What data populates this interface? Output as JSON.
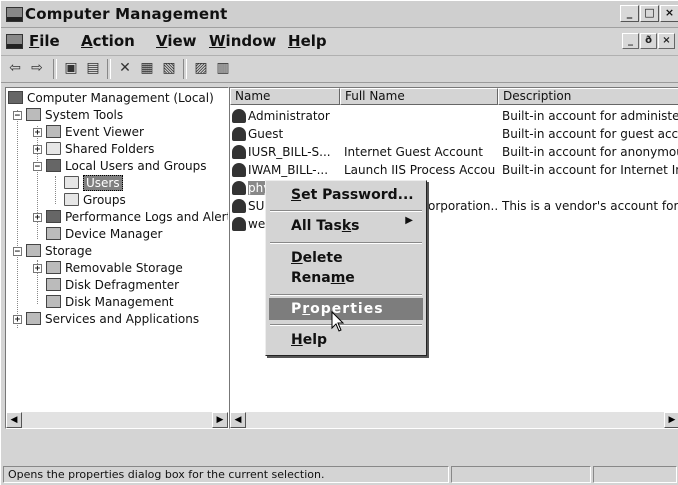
{
  "window": {
    "title": "Computer Management"
  },
  "window_buttons": [
    "_",
    "□",
    "×"
  ],
  "mdi_buttons": [
    "_",
    "ð",
    "×"
  ],
  "menu": [
    {
      "label": "File",
      "accel": "F",
      "rest": "ile"
    },
    {
      "label": "Action",
      "accel": "A",
      "rest": "ction"
    },
    {
      "label": "View",
      "accel": "V",
      "rest": "iew"
    },
    {
      "label": "Window",
      "accel": "W",
      "rest": "indow"
    },
    {
      "label": "Help",
      "accel": "H",
      "rest": "elp"
    }
  ],
  "toolbar": {
    "back": "⇦",
    "forward": "⇨",
    "up": "▣",
    "show_hide": "▤",
    "delete": "✕",
    "properties": "▦",
    "export": "▧",
    "help": "▨",
    "tree": "▥"
  },
  "tree": {
    "root": "Computer Management (Local)",
    "system_tools": "System Tools",
    "event_viewer": "Event Viewer",
    "shared_folders": "Shared Folders",
    "local_users_groups": "Local Users and Groups",
    "users": "Users",
    "groups": "Groups",
    "perf_logs": "Performance Logs and Alerts",
    "device_manager": "Device Manager",
    "storage": "Storage",
    "removable_storage": "Removable Storage",
    "disk_defrag": "Disk Defragmenter",
    "disk_mgmt": "Disk Management",
    "services_apps": "Services and Applications"
  },
  "list": {
    "columns": [
      "Name",
      "Full Name",
      "Description"
    ],
    "rows": [
      {
        "name": "Administrator",
        "full": "",
        "desc": "Built-in account for administering t"
      },
      {
        "name": "Guest",
        "full": "",
        "desc": "Built-in account for guest access to"
      },
      {
        "name": "IUSR_BILL-S...",
        "full": "Internet Guest Account",
        "desc": "Built-in account for anonymous acc"
      },
      {
        "name": "IWAM_BILL-...",
        "full": "Launch IIS Process Account",
        "desc": "Built-in account for Internet Inform"
      },
      {
        "name": "phy",
        "full": "",
        "desc": ""
      },
      {
        "name": "SUI",
        "full": "orporation...",
        "desc": "This is a vendor's account for the H"
      },
      {
        "name": "we",
        "full": "",
        "desc": ""
      }
    ]
  },
  "context_menu": {
    "set_password": {
      "accel": "S",
      "rest": "et Password..."
    },
    "all_tasks": {
      "label": "All Tasks",
      "accel": "k",
      "pre": "All Tas",
      "post": "s"
    },
    "delete": {
      "accel": "D",
      "rest": "elete"
    },
    "rename": {
      "pre": "Rena",
      "accel": "m",
      "post": "e"
    },
    "properties": {
      "pre": "P",
      "accel": "r",
      "post": "operties"
    },
    "help": {
      "accel": "H",
      "rest": "elp"
    }
  },
  "status": {
    "message": "Opens the properties dialog box for the current selection."
  }
}
